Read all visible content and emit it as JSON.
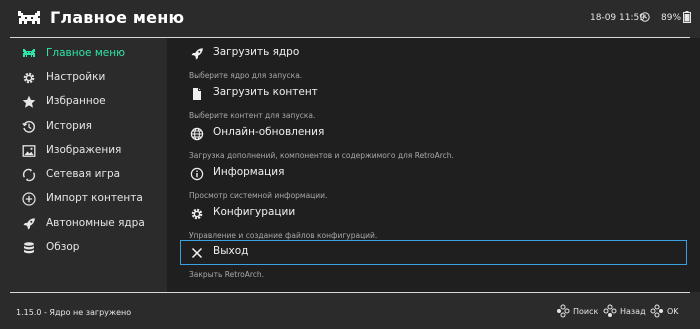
{
  "header": {
    "title": "Главное меню",
    "clock": "18-09 11:59",
    "battery": "89%"
  },
  "sidebar": {
    "items": [
      {
        "label": "Главное меню",
        "icon": "retroarch-logo-icon",
        "active": true
      },
      {
        "label": "Настройки",
        "icon": "gear-icon"
      },
      {
        "label": "Избранное",
        "icon": "star-icon"
      },
      {
        "label": "История",
        "icon": "history-icon"
      },
      {
        "label": "Изображения",
        "icon": "image-icon"
      },
      {
        "label": "Сетевая игра",
        "icon": "netplay-icon"
      },
      {
        "label": "Импорт контента",
        "icon": "plus-icon"
      },
      {
        "label": "Автономные ядра",
        "icon": "rocket-icon"
      },
      {
        "label": "Обзор",
        "icon": "database-icon"
      }
    ]
  },
  "menu": {
    "entries": [
      {
        "label": "Загрузить ядро",
        "sublabel": "Выберите ядро для запуска.",
        "icon": "rocket-icon"
      },
      {
        "label": "Загрузить контент",
        "sublabel": "Выберите контент для запуска.",
        "icon": "file-icon"
      },
      {
        "label": "Онлайн-обновления",
        "sublabel": "Загрузка дополнений, компонентов и содержимого для RetroArch.",
        "icon": "globe-icon"
      },
      {
        "label": "Информация",
        "sublabel": "Просмотр системной информации.",
        "icon": "info-icon"
      },
      {
        "label": "Конфигурации",
        "sublabel": "Управление и создание файлов конфигураций.",
        "icon": "gear-icon"
      },
      {
        "label": "Выход",
        "sublabel": "Закрыть RetroArch.",
        "icon": "close-icon",
        "selected": true
      }
    ]
  },
  "footer": {
    "version": "1.15.0 - Ядро не загружено",
    "search_label": "Поиск",
    "back_label": "Назад",
    "ok_label": "OK"
  },
  "colors": {
    "accent": "#2ee6a6",
    "selection": "#3aa0e0",
    "background": "#2b2b2b",
    "content_background": "#1f1f1f"
  }
}
